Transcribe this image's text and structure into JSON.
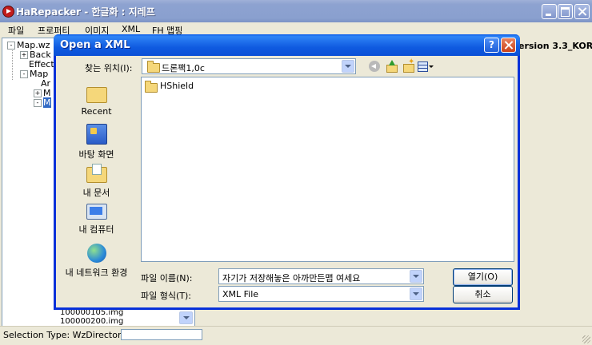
{
  "main_window": {
    "title": "HaRepacker - 한글화 : 지레프",
    "menu": [
      "파일",
      "프로퍼티",
      "이미지",
      "XML",
      "FH 맵핑"
    ],
    "version_label": "ersion 3.3_KOR",
    "tree": [
      {
        "label": "Map.wz",
        "expander": "-"
      },
      {
        "label": "Back",
        "expander": "+"
      },
      {
        "label": "Effect",
        "expander": ""
      },
      {
        "label": "Map",
        "expander": "-"
      },
      {
        "label": "Ar",
        "expander": ""
      },
      {
        "label": "M",
        "expander": "+"
      },
      {
        "label": "M",
        "expander": "-",
        "selected": true
      }
    ],
    "list_snippet_1": "100000105.img",
    "list_snippet_2": "100000200.img",
    "status_text": "Selection Type: WzDirectory"
  },
  "dialog": {
    "title": "Open a XML",
    "help_label": "?",
    "look_in_label": "찾는 위치(I):",
    "look_in_value": "드론팩1,0c",
    "places": [
      {
        "label": "Recent",
        "icon": "recent-icon"
      },
      {
        "label": "바탕 화면",
        "icon": "desktop-icon"
      },
      {
        "label": "내 문서",
        "icon": "my-documents-icon"
      },
      {
        "label": "내 컴퓨터",
        "icon": "my-computer-icon"
      },
      {
        "label": "내 네트워크 환경",
        "icon": "network-icon"
      }
    ],
    "files": [
      {
        "name": "HShield",
        "type": "folder"
      }
    ],
    "filename_label": "파일 이름(N):",
    "filename_value": "자기가 저장해놓은 아까만든맵 여세요",
    "filetype_label": "파일 형식(T):",
    "filetype_value": "XML File",
    "open_button": "열기(O)",
    "cancel_button": "취소"
  },
  "colors": {
    "dialog_titlebar": "#0a5ce8",
    "main_titlebar_inactive": "#8aa0cf",
    "selection": "#316ac5"
  }
}
